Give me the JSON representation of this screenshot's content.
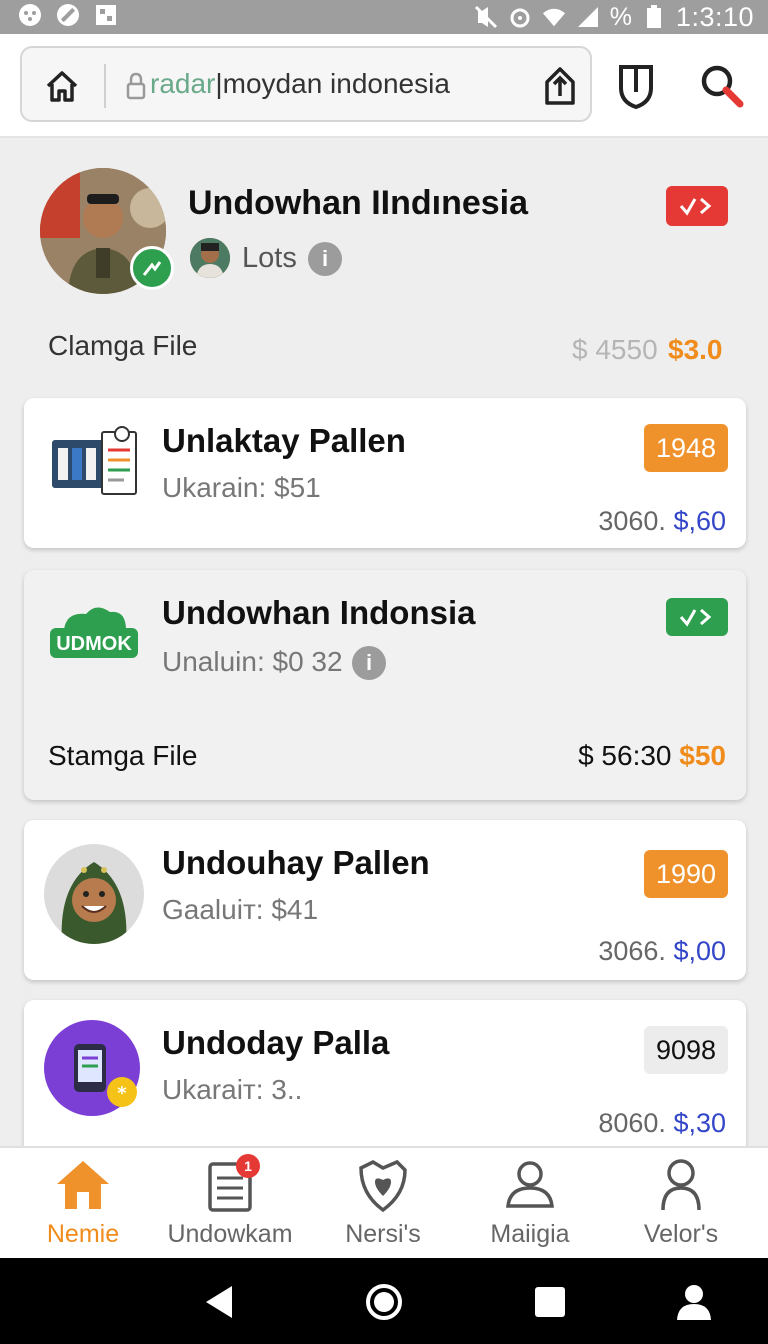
{
  "status_bar": {
    "time": "1:3:10",
    "battery_text": "%"
  },
  "browser": {
    "url_scheme": "radar",
    "url_rest": "|moydan indonesia"
  },
  "profile": {
    "name": "Undowhan IIndınesia",
    "secondary_label": "Lots",
    "file_label": "Clamga File",
    "price_old": "$ 4550",
    "price_new": "$3.0",
    "badge_color": "#e53935"
  },
  "cards": [
    {
      "title": "Unlaktay Pallen",
      "subtitle": "Ukarain: $51",
      "badge": "1948",
      "price_main": "3060.",
      "price_accent": "$,60"
    },
    {
      "title": "Undowhan Indonsia",
      "subtitle": "Unaluin: $0 32",
      "logo_text": "UDMOK",
      "footer_label": "Stamga File",
      "price_main": "$ 56:30",
      "price_accent": "$50"
    },
    {
      "title": "Undouhay Pallen",
      "subtitle": "Gaaluiт: $41",
      "badge": "1990",
      "price_main": "3066.",
      "price_accent": "$,00"
    },
    {
      "title": "Undoday Palla",
      "subtitle": "Ukaraiт: 3..",
      "badge": "9098",
      "price_main": "8060.",
      "price_accent": "$,30"
    }
  ],
  "bottom_nav": [
    {
      "label": "Nemie",
      "icon": "home-icon",
      "active": true
    },
    {
      "label": "Undowkam",
      "icon": "list-icon",
      "badge": "1"
    },
    {
      "label": "Nersi's",
      "icon": "heart-shield-icon"
    },
    {
      "label": "Maiigia",
      "icon": "person-icon"
    },
    {
      "label": "Velor's",
      "icon": "user-icon"
    }
  ],
  "colors": {
    "accent": "#f08c1b",
    "link_blue": "#3346c8",
    "success": "#2e9e4f",
    "danger": "#e53935"
  }
}
